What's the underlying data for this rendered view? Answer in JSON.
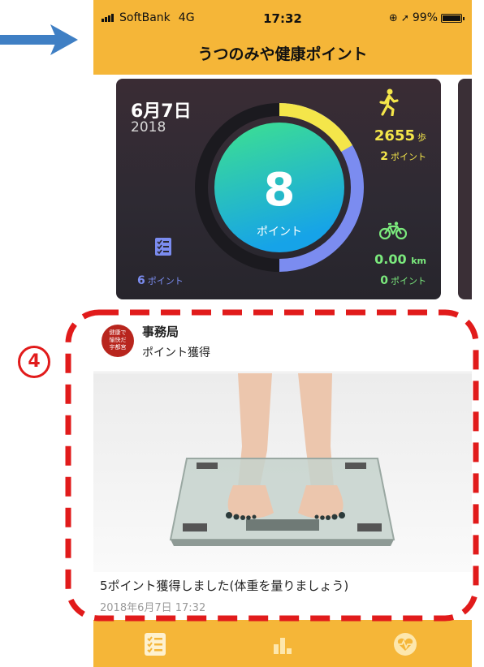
{
  "annotation": {
    "marker_number": "4",
    "arrow_color": "#3f7fc4",
    "highlight_color": "#e11b1b"
  },
  "status_bar": {
    "carrier": "SoftBank",
    "network": "4G",
    "time": "17:32",
    "battery": "99%"
  },
  "header": {
    "title": "うつのみや健康ポイント"
  },
  "summary": {
    "date": "6月7日",
    "year": "2018",
    "total_points": "8",
    "total_points_label": "ポイント",
    "walking": {
      "steps": "2655",
      "steps_unit": "歩",
      "points": "2",
      "points_unit": "ポイント",
      "icon": "walking-person-icon"
    },
    "cycling": {
      "distance": "0.00",
      "distance_unit": "km",
      "points": "0",
      "points_unit": "ポイント",
      "icon": "bicycle-icon"
    },
    "tasks": {
      "points": "6",
      "points_unit": "ポイント",
      "icon": "checklist-icon"
    },
    "colors": {
      "walk": "#f4e64a",
      "bike": "#7bea7d",
      "task": "#7b8cf0",
      "ring_start": "#3ee18f",
      "ring_end": "#1aa8e6"
    }
  },
  "post": {
    "avatar_text": "健康で愉快だ宇都宮",
    "author": "事務局",
    "action": "ポイント獲得",
    "image": "bathroom-scale-photo",
    "message": "5ポイント獲得しました(体重を量りましょう)",
    "timestamp": "2018年6月7日 17:32"
  },
  "tab_bar": {
    "tabs": [
      {
        "icon": "list-icon"
      },
      {
        "icon": "bar-chart-icon"
      },
      {
        "icon": "heart-rate-icon"
      }
    ]
  }
}
